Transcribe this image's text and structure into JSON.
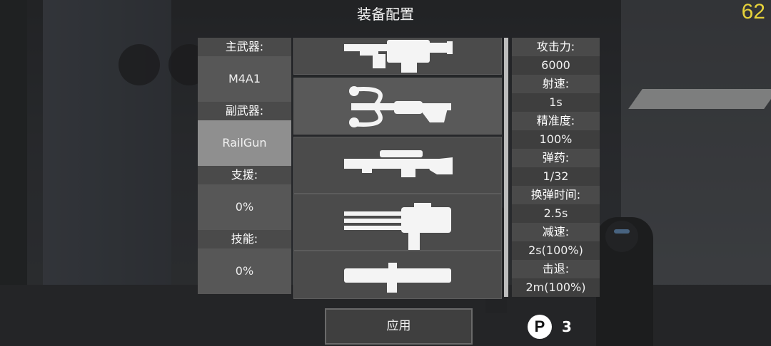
{
  "header": {
    "title": "装备配置",
    "fps": "62"
  },
  "loadout": {
    "primary_label": "主武器:",
    "primary_value": "M4A1",
    "secondary_label": "副武器:",
    "secondary_value": "RailGun",
    "support_label": "支援:",
    "support_value": "0%",
    "skill_label": "技能:",
    "skill_value": "0%"
  },
  "weapons": [
    {
      "icon": "assault-rifle-icon"
    },
    {
      "icon": "crossbow-icon"
    },
    {
      "icon": "sniper-rifle-icon"
    },
    {
      "icon": "minigun-icon"
    },
    {
      "icon": "rocket-launcher-icon"
    }
  ],
  "stats": [
    {
      "label": "攻击力:",
      "value": "6000"
    },
    {
      "label": "射速:",
      "value": "1s"
    },
    {
      "label": "精准度:",
      "value": "100%"
    },
    {
      "label": "弹药:",
      "value": "1/32"
    },
    {
      "label": "换弹时间:",
      "value": "2.5s"
    },
    {
      "label": "减速:",
      "value": "2s(100%)"
    },
    {
      "label": "击退:",
      "value": "2m(100%)"
    }
  ],
  "footer": {
    "apply_label": "应用",
    "points": "3",
    "points_icon": "P"
  }
}
